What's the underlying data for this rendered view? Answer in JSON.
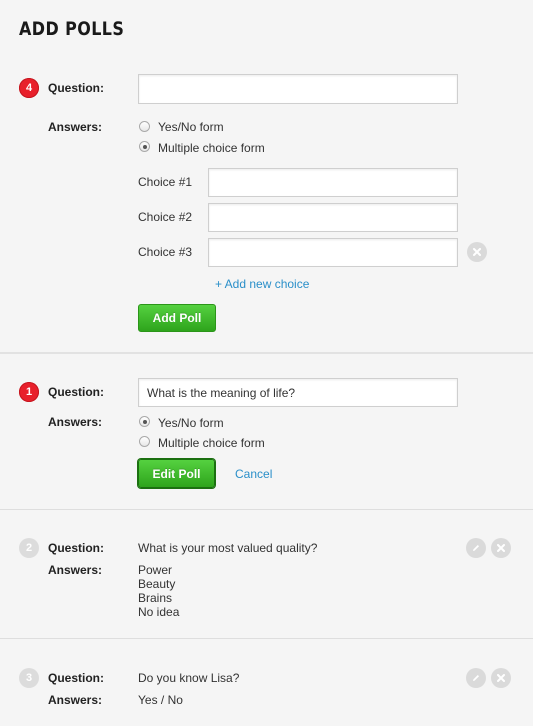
{
  "page": {
    "title": "ADD POLLS"
  },
  "new_poll": {
    "number": "4",
    "question_label": "Question:",
    "question_value": "",
    "answers_label": "Answers:",
    "options": {
      "yes_no": "Yes/No form",
      "multiple": "Multiple choice form"
    },
    "selected": "multiple",
    "choices": [
      {
        "label": "Choice #1",
        "value": ""
      },
      {
        "label": "Choice #2",
        "value": ""
      },
      {
        "label": "Choice #3",
        "value": ""
      }
    ],
    "add_choice_label": "+ Add new choice",
    "submit_label": "Add Poll"
  },
  "edit_poll": {
    "number": "1",
    "question_label": "Question:",
    "question_value": "What is the meaning of life?",
    "answers_label": "Answers:",
    "options": {
      "yes_no": "Yes/No form",
      "multiple": "Multiple choice form"
    },
    "selected": "yes_no",
    "submit_label": "Edit Poll",
    "cancel_label": "Cancel"
  },
  "polls": [
    {
      "number": "2",
      "question_label": "Question:",
      "question": "What is your most valued quality?",
      "answers_label": "Answers:",
      "answers": [
        "Power",
        "Beauty",
        "Brains",
        "No idea"
      ]
    },
    {
      "number": "3",
      "question_label": "Question:",
      "question": "Do you know Lisa?",
      "answers_label": "Answers:",
      "answers": [
        "Yes / No"
      ]
    }
  ],
  "icons": {
    "edit": "pencil-icon",
    "delete": "close-icon"
  },
  "colors": {
    "badge_active": "#e8202b",
    "button": "#3cb82a",
    "link": "#2a8fc9"
  }
}
